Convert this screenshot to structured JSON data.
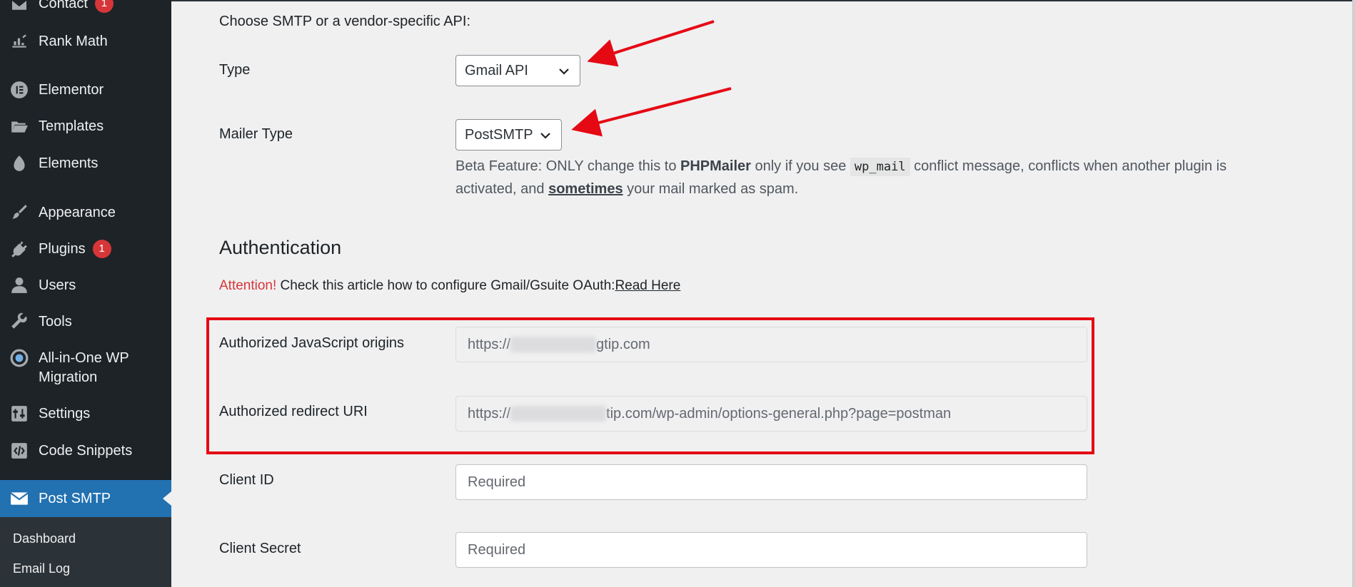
{
  "sidebar": {
    "items": [
      {
        "name": "contact",
        "label": "Contact",
        "badge": "1",
        "icon": "mail-icon"
      },
      {
        "name": "rank-math",
        "label": "Rank Math",
        "icon": "chart-icon"
      },
      {
        "name": "elementor",
        "label": "Elementor",
        "icon": "elementor-icon"
      },
      {
        "name": "templates",
        "label": "Templates",
        "icon": "folder-icon"
      },
      {
        "name": "elements",
        "label": "Elements",
        "icon": "leaf-icon"
      },
      {
        "name": "appearance",
        "label": "Appearance",
        "icon": "brush-icon"
      },
      {
        "name": "plugins",
        "label": "Plugins",
        "badge": "1",
        "icon": "plug-icon"
      },
      {
        "name": "users",
        "label": "Users",
        "icon": "user-icon"
      },
      {
        "name": "tools",
        "label": "Tools",
        "icon": "wrench-icon"
      },
      {
        "name": "all-in-one",
        "label": "All-in-One WP",
        "label2": "Migration",
        "icon": "migration-icon"
      },
      {
        "name": "settings",
        "label": "Settings",
        "icon": "sliders-icon"
      },
      {
        "name": "code-snippets",
        "label": "Code Snippets",
        "icon": "code-icon"
      }
    ],
    "active": {
      "label": "Post SMTP",
      "icon": "envelope-icon"
    },
    "submenu": [
      "Dashboard",
      "Email Log"
    ]
  },
  "form": {
    "intro": "Choose SMTP or a vendor-specific API:",
    "type_label": "Type",
    "type_value": "Gmail API",
    "mailer_label": "Mailer Type",
    "mailer_value": "PostSMTP",
    "beta": {
      "prefix": "Beta Feature: ONLY change this to ",
      "phpmailer": "PHPMailer",
      "mid": " only if you see ",
      "code": "wp_mail",
      "suffix": " conflict message, conflicts when another plugin is",
      "line2_prefix": "activated, and ",
      "sometimes": "sometimes",
      "line2_suffix": " your mail marked as spam."
    },
    "auth_heading": "Authentication",
    "attention": "Attention!",
    "attention_text": " Check this article how to configure Gmail/Gsuite OAuth:",
    "read_here": "Read Here",
    "js_origins_label": "Authorized JavaScript origins",
    "js_origins_prefix": "https://",
    "js_origins_suffix": "gtip.com",
    "redirect_label": "Authorized redirect URI",
    "redirect_prefix": "https://",
    "redirect_suffix": "tip.com/wp-admin/options-general.php?page=postman",
    "client_id_label": "Client ID",
    "client_id_placeholder": "Required",
    "client_secret_label": "Client Secret",
    "client_secret_placeholder": "Required"
  },
  "colors": {
    "accent": "#2271b1",
    "annotation": "#e50914",
    "attention": "#d63638"
  }
}
